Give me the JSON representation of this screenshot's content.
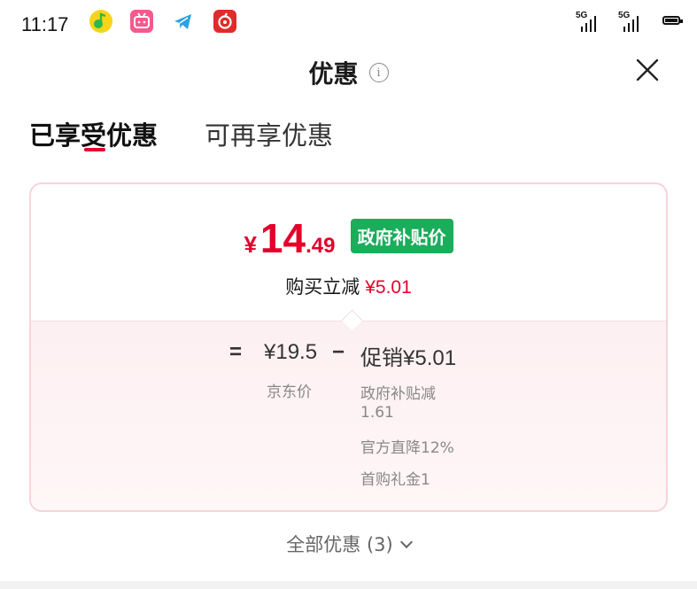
{
  "status_bar": {
    "time": "11:17",
    "apps": [
      "music-app-icon",
      "bilibili-icon",
      "telegram-icon",
      "netease-music-icon"
    ],
    "signal1": "5G",
    "signal2": "5G"
  },
  "header": {
    "title": "优惠",
    "info_icon_glyph": "i"
  },
  "tabs": [
    {
      "label": "已享受优惠",
      "active": true
    },
    {
      "label": "可再享优惠",
      "active": false
    }
  ],
  "card": {
    "price_symbol": "¥",
    "price_int": "14",
    "price_dec": ".49",
    "badge": "政府补贴价",
    "discount_label": "购买立减",
    "discount_amount": "¥5.01",
    "calc_equals": "=",
    "jd_price": "¥19.5",
    "calc_minus": "−",
    "promo_label": "促销",
    "promo_amount": "¥5.01",
    "jd_price_label": "京东价",
    "details": [
      "政府补贴减",
      "1.61",
      "官方直降12%",
      "首购礼金1"
    ]
  },
  "footer": {
    "all_offers": "全部优惠 (3)"
  },
  "colors": {
    "accent_red": "#e4002b",
    "badge_green": "#1aad5a",
    "card_border": "#f7d3da"
  }
}
